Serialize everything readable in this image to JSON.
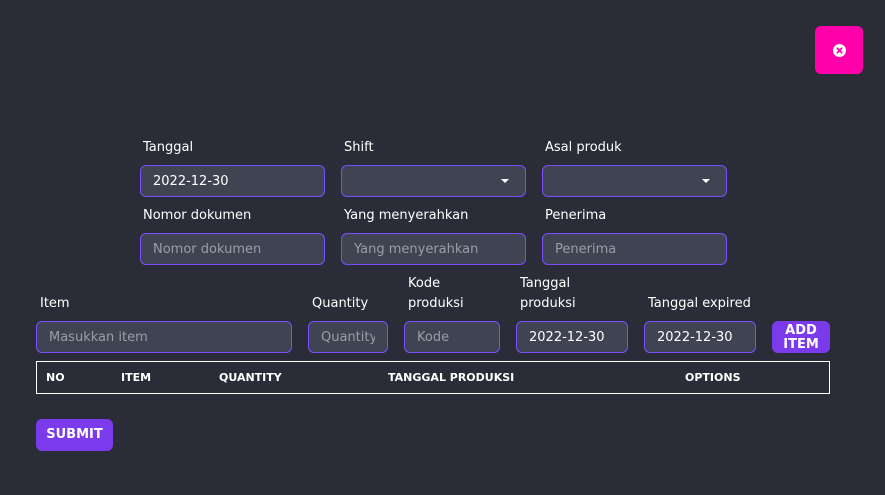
{
  "close_button": {
    "icon": "close-circle-icon",
    "color": "#ff00aa"
  },
  "form": {
    "tanggal": {
      "label": "Tanggal",
      "value": "2022-12-30"
    },
    "shift": {
      "label": "Shift",
      "value": ""
    },
    "asal_produk": {
      "label": "Asal produk",
      "value": ""
    },
    "nomor_dokumen": {
      "label": "Nomor dokumen",
      "value": "",
      "placeholder": "Nomor dokumen"
    },
    "yang_menyerahkan": {
      "label": "Yang menyerahkan",
      "value": "",
      "placeholder": "Yang menyerahkan"
    },
    "penerima": {
      "label": "Penerima",
      "value": "",
      "placeholder": "Penerima"
    }
  },
  "item_entry": {
    "item": {
      "label": "Item",
      "value": "",
      "placeholder": "Masukkan item"
    },
    "quantity": {
      "label": "Quantity",
      "value": "",
      "placeholder": "Quantity"
    },
    "kode_produksi": {
      "label_line1": "Kode",
      "label_line2": "produksi",
      "value": "",
      "placeholder": "Kode"
    },
    "tanggal_produksi": {
      "label_line1": "Tanggal",
      "label_line2": "produksi",
      "value": "2022-12-30"
    },
    "tanggal_expired": {
      "label": "Tanggal expired",
      "value": "2022-12-30"
    },
    "add_item_line1": "ADD",
    "add_item_line2": "ITEM"
  },
  "table": {
    "columns": [
      "NO",
      "ITEM",
      "QUANTITY",
      "TANGGAL PRODUKSI",
      "OPTIONS"
    ],
    "rows": []
  },
  "submit_label": "SUBMIT",
  "colors": {
    "background": "#2a2d37",
    "input_bg": "#404452",
    "input_border": "#7c4dff",
    "button": "#7c3aed",
    "close": "#ff00aa"
  }
}
